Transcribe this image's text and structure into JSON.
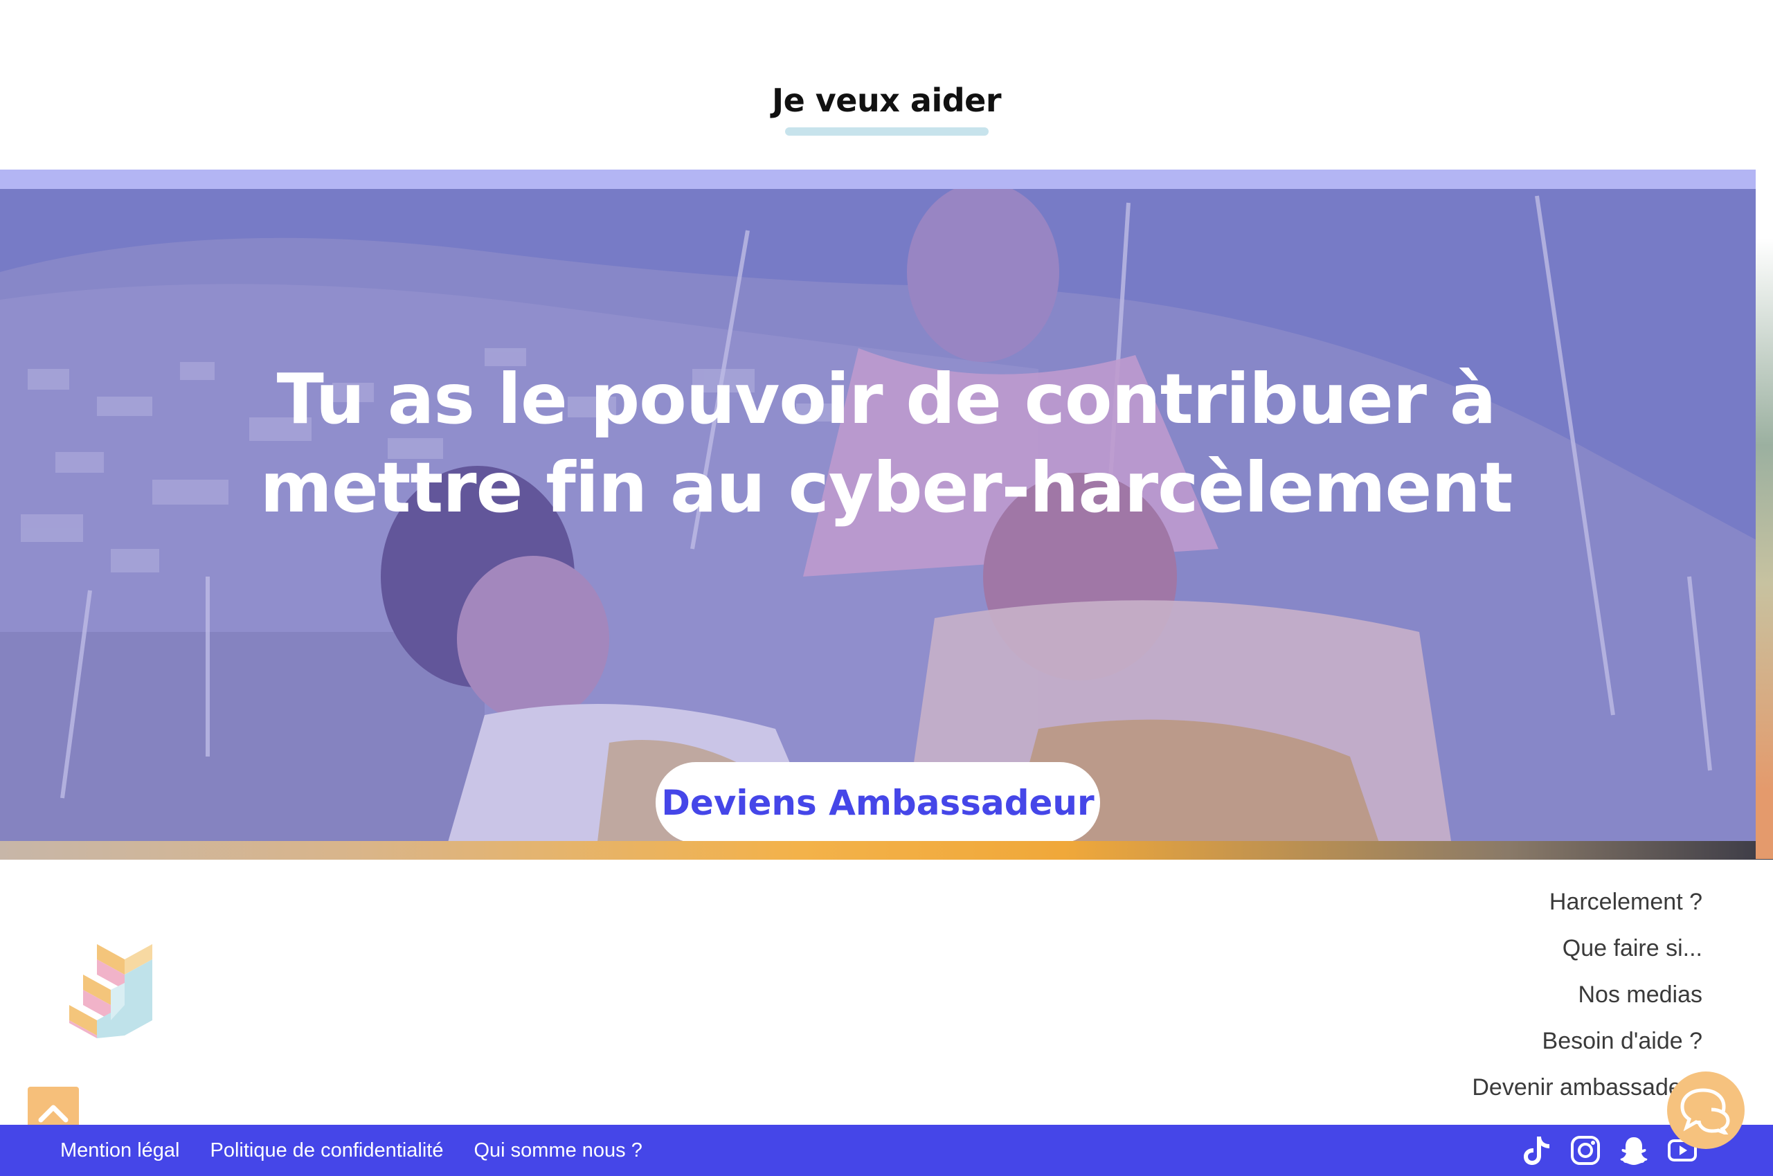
{
  "section": {
    "title": "Je veux aider"
  },
  "hero": {
    "heading": "Tu as le pouvoir de contribuer à\nmettre fin au cyber-harcèlement",
    "cta_label": "Deviens Ambassadeur",
    "overlay_color": "#7b7fd0"
  },
  "footer_nav": {
    "items": [
      {
        "label": "Harcelement ?"
      },
      {
        "label": "Que faire si..."
      },
      {
        "label": "Nos medias"
      },
      {
        "label": "Besoin d'aide ?"
      },
      {
        "label": "Devenir ambassadeur"
      }
    ]
  },
  "bottom_bar": {
    "links": [
      {
        "label": "Mention légal"
      },
      {
        "label": "Politique de confidentialité"
      },
      {
        "label": "Qui somme nous ?"
      }
    ],
    "social": [
      {
        "icon": "tiktok-icon"
      },
      {
        "icon": "instagram-icon"
      },
      {
        "icon": "snapchat-icon"
      },
      {
        "icon": "youtube-icon"
      }
    ]
  },
  "colors": {
    "brand_primary": "#4546e8",
    "accent_orange": "#f6c27e",
    "title_underline": "#c7e3ec",
    "hero_band": "#b3b5f4"
  },
  "icons": {
    "logo": "stairs-logo-icon",
    "scroll_top": "chevron-up-icon",
    "chat": "chat-bubbles-icon"
  }
}
